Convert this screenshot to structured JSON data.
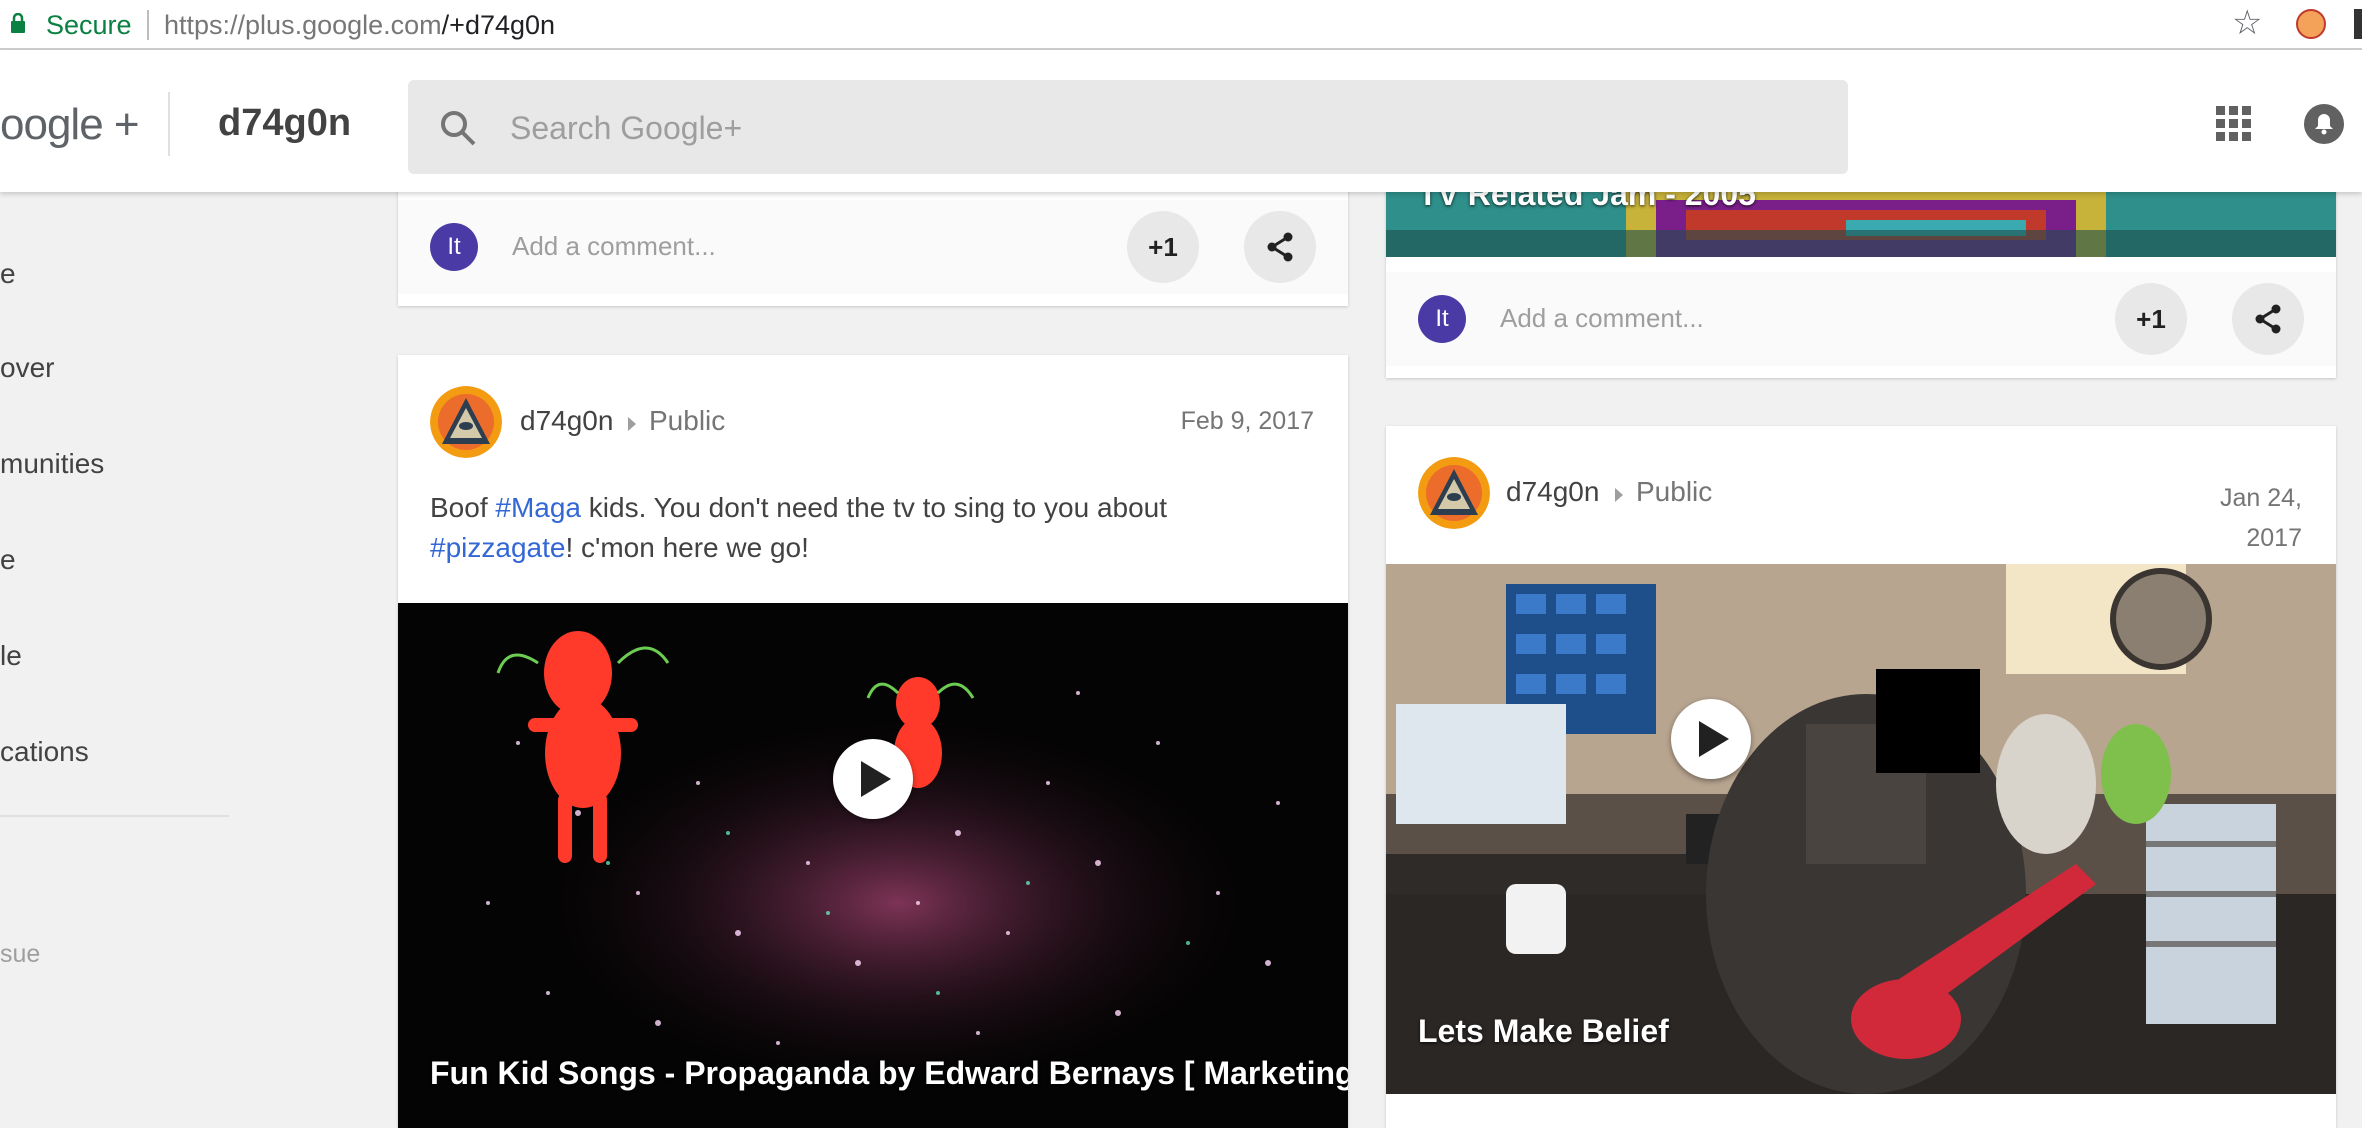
{
  "browser": {
    "secure_label": "Secure",
    "url_host": "https://plus.google.com",
    "url_path": "/+d74g0n"
  },
  "header": {
    "logo_text": "oogle +",
    "profile_name": "d74g0n",
    "search_placeholder": "Search Google+"
  },
  "sidebar": {
    "items": [
      {
        "label": "e"
      },
      {
        "label": "over"
      },
      {
        "label": "munities"
      },
      {
        "label": "e"
      },
      {
        "label": "le"
      },
      {
        "label": "cations"
      }
    ],
    "issue_label": "sue"
  },
  "left_column": {
    "top_card": {
      "commenter_initials": "It",
      "comment_placeholder": "Add a comment...",
      "plus_one_label": "+1"
    },
    "post": {
      "author": "d74g0n",
      "visibility": "Public",
      "date": "Feb 9, 2017",
      "text_before_1": "Boof ",
      "hashtag_1": "#Maga",
      "text_after_1": " kids.  You don't need the tv to sing to you about",
      "hashtag_2": "#pizzagate",
      "text_after_2": "! c'mon here we go!",
      "video_title": "Fun Kid Songs - Propaganda by Edward Bernays [ Marketing ..."
    }
  },
  "right_column": {
    "top_card": {
      "video_title_partial": "TV Related Jam - 2005",
      "commenter_initials": "It",
      "comment_placeholder": "Add a comment...",
      "plus_one_label": "+1"
    },
    "post": {
      "author": "d74g0n",
      "visibility": "Public",
      "date_line1": "Jan 24,",
      "date_line2": "2017",
      "video_title": "Lets Make Belief"
    }
  },
  "colors": {
    "hashtag": "#3367d6",
    "secure_green": "#0b8043",
    "commenter_avatar": "#4a3aa6"
  }
}
